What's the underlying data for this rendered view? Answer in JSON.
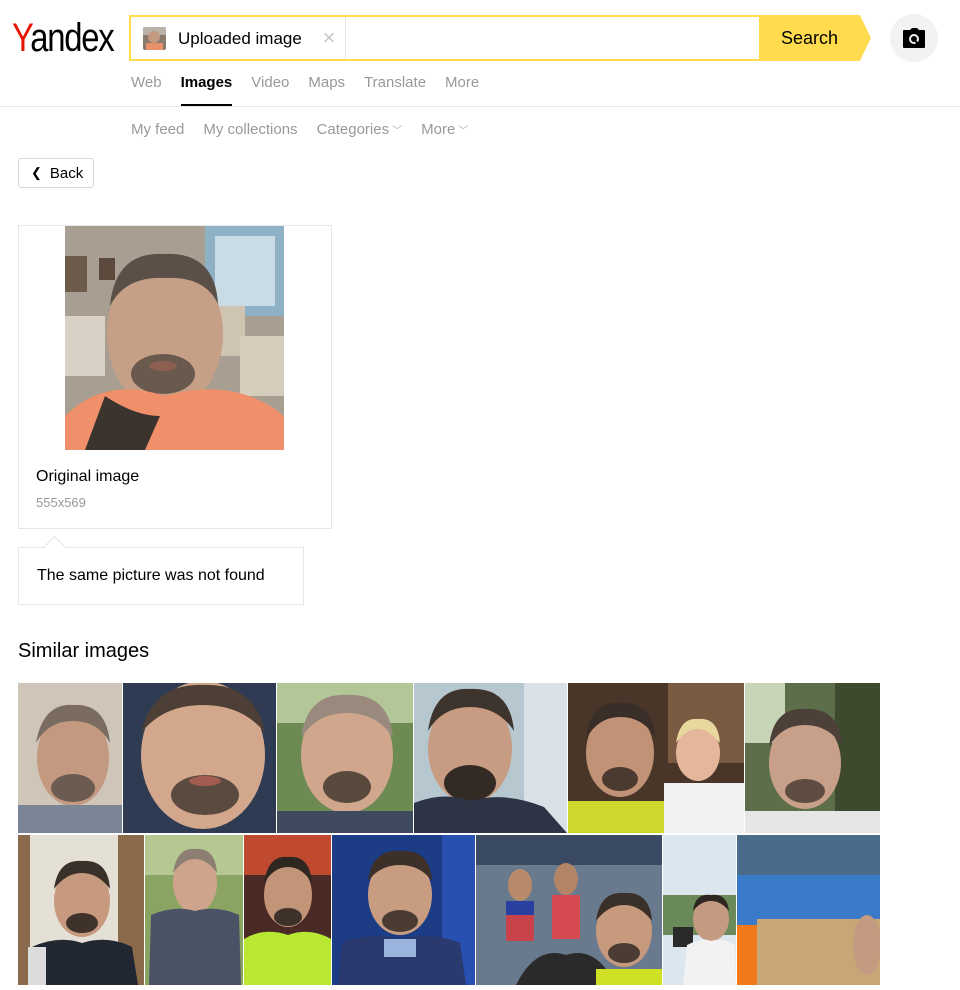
{
  "header": {
    "logo_text": "Yandex",
    "logo_first_letter": "Y",
    "logo_rest": "andex",
    "search": {
      "chip_label": "Uploaded image",
      "clear_glyph": "×",
      "input_value": "",
      "button_label": "Search"
    },
    "camera_icon": "camera-icon"
  },
  "tabs": [
    {
      "label": "Web",
      "active": false
    },
    {
      "label": "Images",
      "active": true
    },
    {
      "label": "Video",
      "active": false
    },
    {
      "label": "Maps",
      "active": false
    },
    {
      "label": "Translate",
      "active": false
    },
    {
      "label": "More",
      "active": false
    }
  ],
  "subnav": {
    "my_feed": "My feed",
    "my_collections": "My collections",
    "categories": "Categories",
    "more": "More"
  },
  "back_label": "Back",
  "original": {
    "title": "Original image",
    "size": "555x569"
  },
  "notfound_text": "The same picture was not found",
  "similar_title": "Similar images",
  "colors": {
    "accent_yellow": "#ffdb4d",
    "logo_red": "#e61400",
    "muted_text": "#999999",
    "border": "#e6e6e6"
  }
}
